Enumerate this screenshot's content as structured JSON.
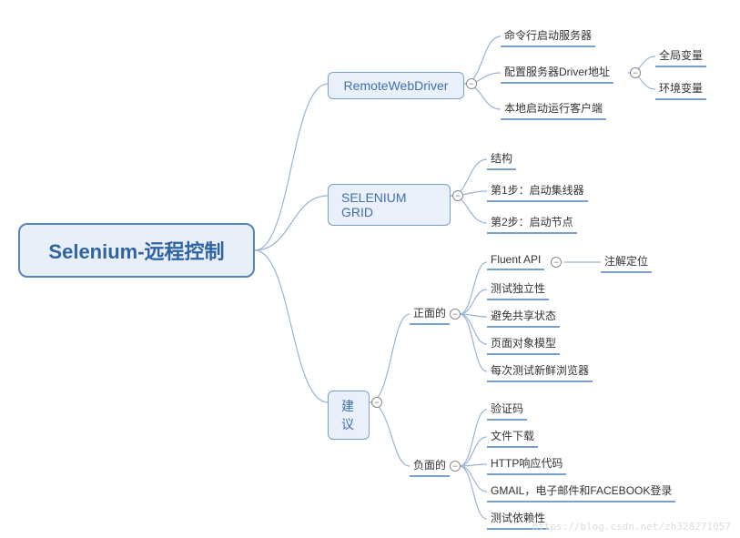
{
  "root": {
    "title": "Selenium-远程控制"
  },
  "branches": {
    "b1": "RemoteWebDriver",
    "b2": "SELENIUM GRID",
    "b3": "建议"
  },
  "b1_children": {
    "c1": "命令行启动服务器",
    "c2": "配置服务器Driver地址",
    "c3": "本地启动运行客户端"
  },
  "b1_c2_children": {
    "d1": "全局变量",
    "d2": "环境变量"
  },
  "b2_children": {
    "c1": "结构",
    "c2": "第1步：启动集线器",
    "c3": "第2步：启动节点"
  },
  "b3_children": {
    "c1": "正面的",
    "c2": "负面的"
  },
  "b3_c1_children": {
    "d1": "Fluent API",
    "d2": "测试独立性",
    "d3": "避免共享状态",
    "d4": "页面对象模型",
    "d5": "每次测试新鲜浏览器"
  },
  "b3_c1_d1_children": {
    "e1": "注解定位"
  },
  "b3_c2_children": {
    "d1": "验证码",
    "d2": "文件下载",
    "d3": "HTTP响应代码",
    "d4": "GMAIL，电子邮件和FACEBOOK登录",
    "d5": "测试依赖性"
  },
  "watermark": "https://blog.csdn.net/zh328271057",
  "collapse_symbol": "−"
}
